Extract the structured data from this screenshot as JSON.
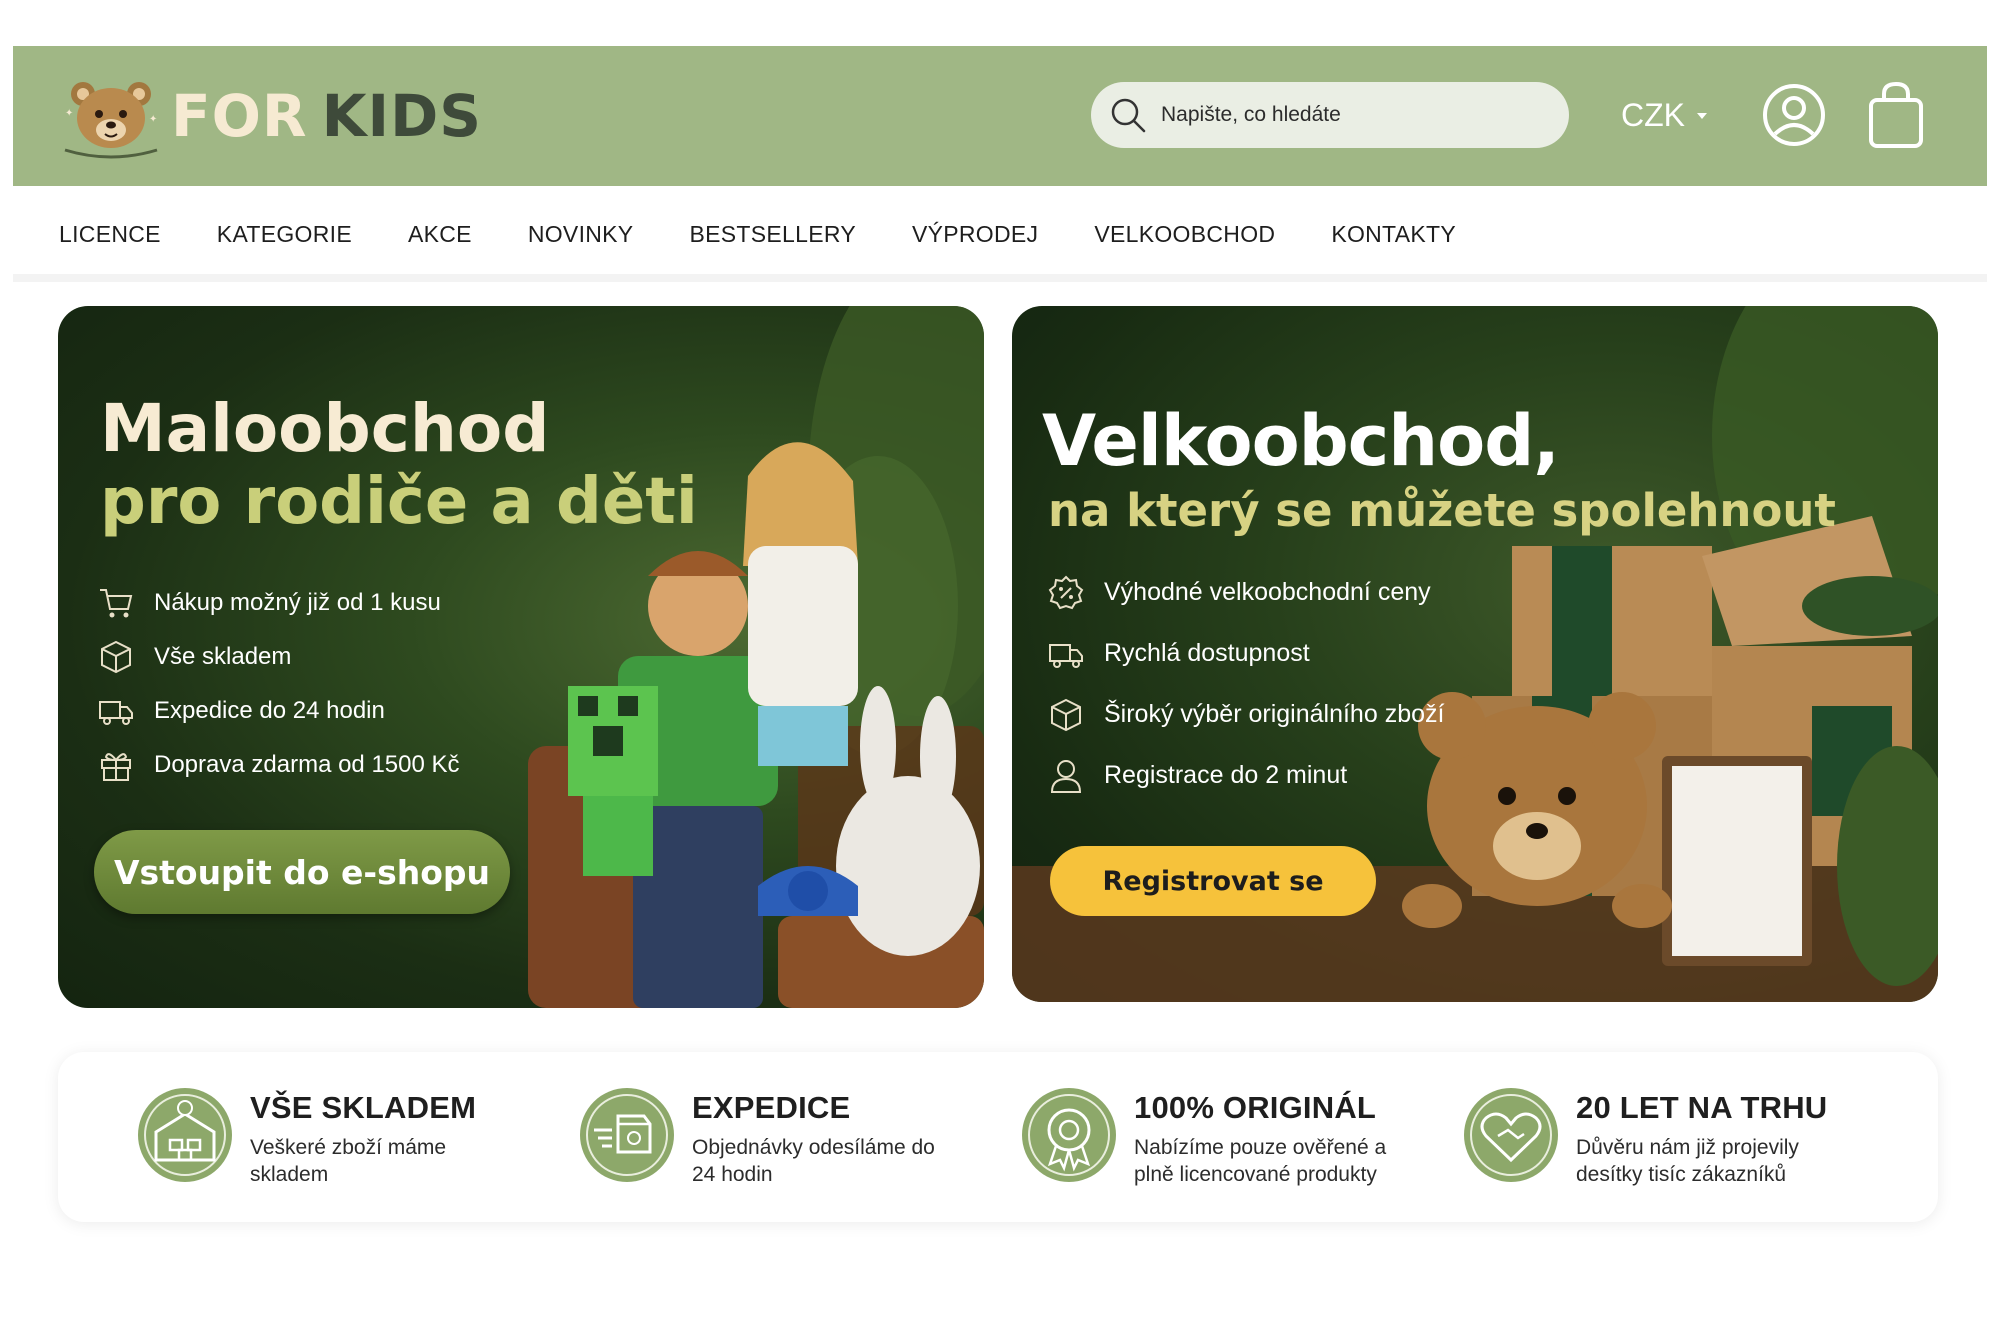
{
  "brand": {
    "logo_for": "FOR",
    "logo_kids": "KIDS"
  },
  "search": {
    "placeholder": "Napište, co hledáte"
  },
  "currency": {
    "selected": "CZK"
  },
  "icons": {
    "search": "search-icon",
    "account": "user-circle-icon",
    "cart": "shopping-bag-icon"
  },
  "nav": {
    "items": [
      "LICENCE",
      "KATEGORIE",
      "AKCE",
      "NOVINKY",
      "BESTSELLERY",
      "VÝPRODEJ",
      "VELKOOBCHOD",
      "KONTAKTY"
    ]
  },
  "retail": {
    "title": "Maloobchod",
    "subtitle": "pro rodiče a děti",
    "features": [
      {
        "icon": "cart-icon",
        "text": "Nákup možný již od 1 kusu"
      },
      {
        "icon": "box-icon",
        "text": "Vše skladem"
      },
      {
        "icon": "truck-icon",
        "text": "Expedice do 24 hodin"
      },
      {
        "icon": "gift-icon",
        "text": "Doprava zdarma od 1500 Kč"
      }
    ],
    "button": "Vstoupit do e-shopu"
  },
  "wholesale": {
    "title": "Velkoobchod,",
    "subtitle": "na který se můžete spolehnout",
    "features": [
      {
        "icon": "percent-badge-icon",
        "text": "Výhodné velkoobchodní ceny"
      },
      {
        "icon": "truck-icon",
        "text": "Rychlá dostupnost"
      },
      {
        "icon": "box-icon",
        "text": "Široký výběr originálního zboží"
      },
      {
        "icon": "user-icon",
        "text": "Registrace do 2 minut"
      }
    ],
    "button": "Registrovat se"
  },
  "trust": [
    {
      "icon": "warehouse-icon",
      "title": "VŠE SKLADEM",
      "text": "Veškeré zboží máme skladem"
    },
    {
      "icon": "delivery-box-icon",
      "title": "EXPEDICE",
      "text": "Objednávky odesíláme do 24 hodin"
    },
    {
      "icon": "original-seal-icon",
      "title": "100% ORIGINÁL",
      "text": "Nabízíme pouze ověřené a plně licencované produkty"
    },
    {
      "icon": "heart-handshake-icon",
      "title": "20 LET NA TRHU",
      "text": "Důvěru nám již projevily desítky tisíc zákazníků"
    }
  ],
  "colors": {
    "header_bg": "#a0b785",
    "accent_green": "#6b8a3a",
    "register_yellow": "#f6c23b",
    "title_cream": "#f7ebd3",
    "subtitle_olive": "#c9cf7a"
  }
}
